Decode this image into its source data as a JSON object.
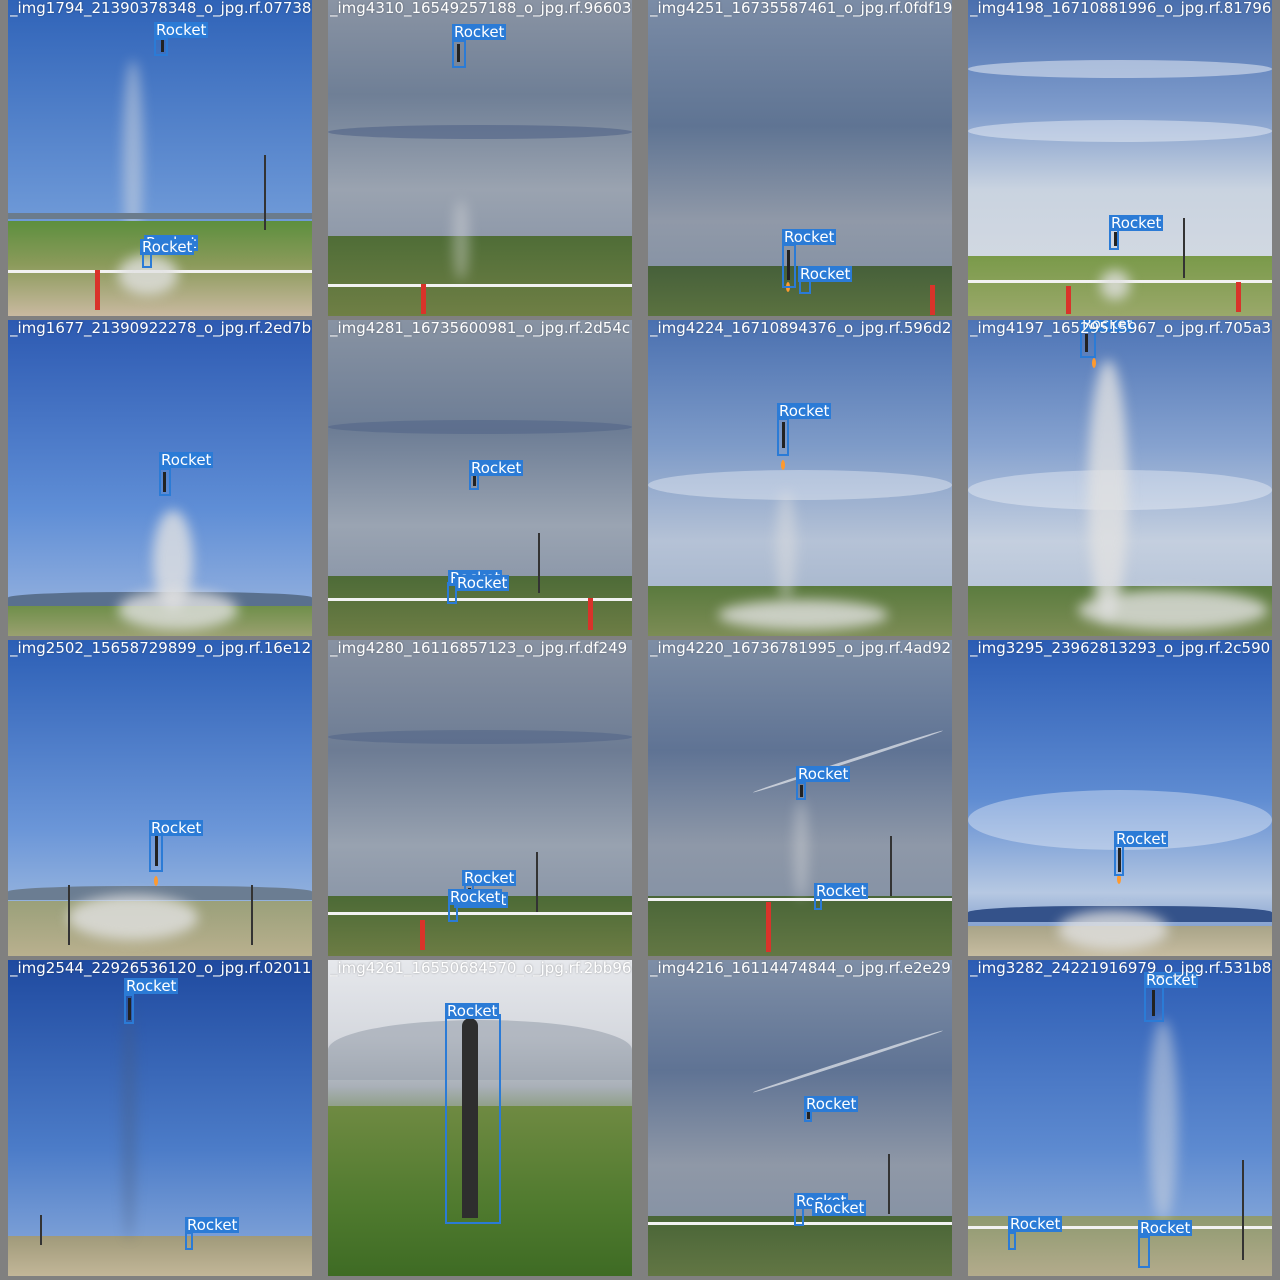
{
  "mosaic": {
    "class_label": "Rocket",
    "box_color": "#2b7bd6",
    "label_text_color": "#ffffff",
    "tiles": [
      {
        "title": "_img1794_21390378348_o_jpg.rf.07738",
        "scene": "clear-blue",
        "detection_count": 3
      },
      {
        "title": "_img4310_16549257188_o_jpg.rf.96603",
        "scene": "gray-overcast",
        "detection_count": 1
      },
      {
        "title": "_img4251_16735587461_o_jpg.rf.0fdf19",
        "scene": "gray-overcast",
        "detection_count": 2
      },
      {
        "title": "_img4198_16710881996_o_jpg.rf.81796",
        "scene": "blue-streaked",
        "detection_count": 1
      },
      {
        "title": "_img1677_21390922278_o_jpg.rf.2ed7b",
        "scene": "clear-blue",
        "detection_count": 1
      },
      {
        "title": "_img4281_16735600981_o_jpg.rf.2d54c",
        "scene": "gray-overcast",
        "detection_count": 3
      },
      {
        "title": "_img4224_16710894376_o_jpg.rf.596d2",
        "scene": "blue-cloudy",
        "detection_count": 1
      },
      {
        "title": "_img4197_16529515967_o_jpg.rf.705a3",
        "scene": "blue-cloudy",
        "detection_count": 1
      },
      {
        "title": "_img2502_15658729899_o_jpg.rf.16e12",
        "scene": "clear-blue",
        "detection_count": 1
      },
      {
        "title": "_img4280_16116857123_o_jpg.rf.df249",
        "scene": "gray-overcast",
        "detection_count": 3
      },
      {
        "title": "_img4220_16736781995_o_jpg.rf.4ad92",
        "scene": "gray-overcast",
        "detection_count": 2
      },
      {
        "title": "_img3295_23962813293_o_jpg.rf.2c590",
        "scene": "blue-cloudy",
        "detection_count": 1
      },
      {
        "title": "_img2544_22926536120_o_jpg.rf.02011",
        "scene": "clear-blue",
        "detection_count": 2
      },
      {
        "title": "_img4261_16550684570_o_jpg.rf.2bb96",
        "scene": "closeup-green",
        "detection_count": 1
      },
      {
        "title": "_img4216_16114474844_o_jpg.rf.e2e29",
        "scene": "gray-overcast",
        "detection_count": 3
      },
      {
        "title": "_img3282_24221916979_o_jpg.rf.531b8",
        "scene": "clear-blue",
        "detection_count": 3
      }
    ]
  }
}
